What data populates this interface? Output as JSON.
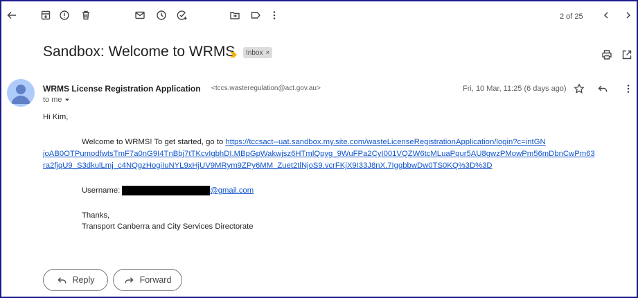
{
  "toolbar": {
    "pager_text": "2 of 25",
    "icons": [
      "back-arrow-icon",
      "archive-icon",
      "report-spam-icon",
      "delete-icon",
      "mark-unread-icon",
      "snooze-icon",
      "add-task-icon",
      "move-to-icon",
      "label-icon",
      "more-vert-icon",
      "chevron-left-icon",
      "chevron-right-icon"
    ]
  },
  "message": {
    "subject": "Sandbox: Welcome to WRMS",
    "label_chip": "Inbox",
    "label_chip_close": "×",
    "sender_name": "WRMS License Registration Application",
    "sender_email": "<tccs.wasteregulation@act.gov.au>",
    "recipient": "to me",
    "date": "Fri, 10 Mar, 11:25 (6 days ago)"
  },
  "body": {
    "greeting": "Hi Kim,",
    "intro": "Welcome to WRMS! To get started, go to",
    "link_part1": "https://tccsact--uat.sandbox.my.site.com/wasteLicenseRegistrationApplication/login?c=intGN",
    "link_part2": "joAB0OTPumodfwtsTmF7a0nG9I4TnBbj7tTKcvIgbhDI.MBpGpWakwjsz6HTmlQpyg_9WuFPa2CyI001VQZW6tcMLuaPqur5AU8gwzPMowPm56mDbnCwPm63",
    "link_part3": "ra2fjqU9_S3dkulLmj_c4NQgzHogiIuNYL9xHjUV9MRym9ZPy6MM_Zuet2tlNjoS9.vcrFKjX9I33J8nX.7IggbbwDw0TS0KQ%3D%3D",
    "username_label": "Username:",
    "username_domain": "@gmail.com",
    "thanks": "Thanks,",
    "signature": "Transport Canberra and City Services Directorate"
  },
  "actions": {
    "reply_label": "Reply",
    "forward_label": "Forward"
  },
  "colors": {
    "link": "#1155cc",
    "frame_border": "#1a1a8c",
    "important_marker": "#f4b400",
    "avatar_bg": "#aecbfa"
  }
}
